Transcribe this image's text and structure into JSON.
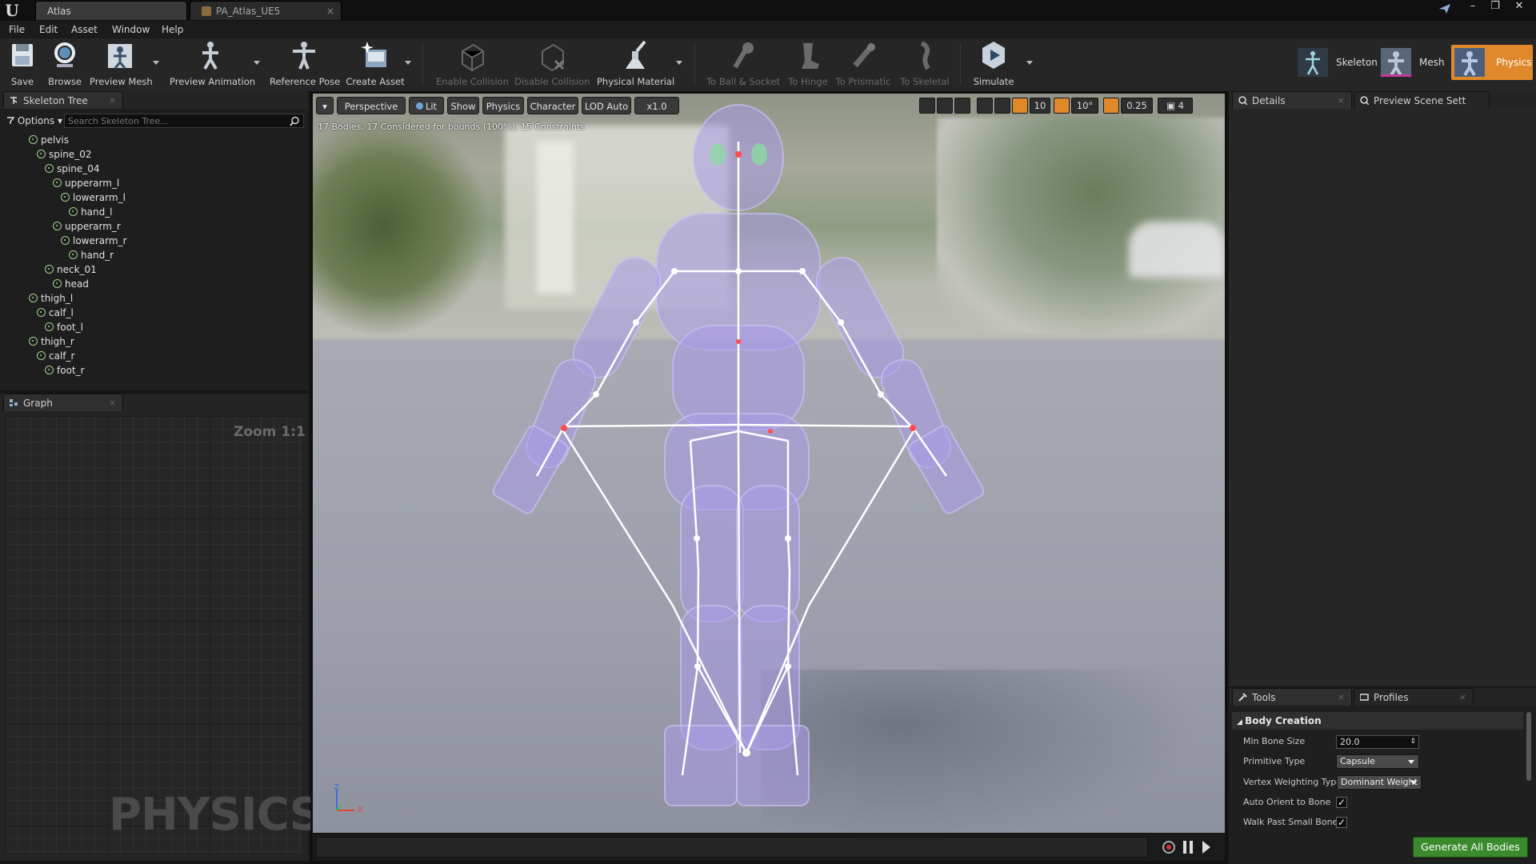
{
  "title_bar": {
    "tabs": [
      {
        "label": "Atlas"
      },
      {
        "label": "PA_Atlas_UE5"
      }
    ]
  },
  "menu": [
    "File",
    "Edit",
    "Asset",
    "Window",
    "Help"
  ],
  "toolbar": {
    "buttons": [
      {
        "label": "Save",
        "icon": "save-icon"
      },
      {
        "label": "Browse",
        "icon": "browse-icon"
      },
      {
        "label": "Preview Mesh",
        "icon": "preview-mesh-icon"
      },
      {
        "label": "Preview Animation",
        "icon": "preview-animation-icon"
      },
      {
        "label": "Reference Pose",
        "icon": "reference-pose-icon"
      },
      {
        "label": "Create Asset",
        "icon": "create-asset-icon"
      },
      {
        "label": "Enable Collision",
        "icon": "enable-collision-icon"
      },
      {
        "label": "Disable Collision",
        "icon": "disable-collision-icon"
      },
      {
        "label": "Physical Material",
        "icon": "physical-material-icon"
      },
      {
        "label": "To Ball & Socket",
        "icon": "ball-socket-icon"
      },
      {
        "label": "To Hinge",
        "icon": "hinge-icon"
      },
      {
        "label": "To Prismatic",
        "icon": "prismatic-icon"
      },
      {
        "label": "To Skeletal",
        "icon": "skeletal-icon"
      },
      {
        "label": "Simulate",
        "icon": "simulate-icon"
      }
    ],
    "modes": [
      {
        "label": "Skeleton"
      },
      {
        "label": "Mesh"
      },
      {
        "label": "Physics",
        "active": true
      }
    ],
    "accent": "#e0892a"
  },
  "skeleton_tree": {
    "tab": "Skeleton Tree",
    "options_label": "Options",
    "search_placeholder": "Search Skeleton Tree...",
    "bones": [
      {
        "name": "pelvis",
        "depth": 0
      },
      {
        "name": "spine_02",
        "depth": 1
      },
      {
        "name": "spine_04",
        "depth": 2
      },
      {
        "name": "upperarm_l",
        "depth": 3
      },
      {
        "name": "lowerarm_l",
        "depth": 4
      },
      {
        "name": "hand_l",
        "depth": 5
      },
      {
        "name": "upperarm_r",
        "depth": 3
      },
      {
        "name": "lowerarm_r",
        "depth": 4
      },
      {
        "name": "hand_r",
        "depth": 5
      },
      {
        "name": "neck_01",
        "depth": 2
      },
      {
        "name": "head",
        "depth": 3
      },
      {
        "name": "thigh_l",
        "depth": 0
      },
      {
        "name": "calf_l",
        "depth": 1
      },
      {
        "name": "foot_l",
        "depth": 2
      },
      {
        "name": "thigh_r",
        "depth": 0
      },
      {
        "name": "calf_r",
        "depth": 1
      },
      {
        "name": "foot_r",
        "depth": 2
      }
    ]
  },
  "graph": {
    "tab": "Graph",
    "zoom": "Zoom 1:1",
    "watermark": "PHYSICS"
  },
  "viewport": {
    "perspective": "Perspective",
    "lit": "Lit",
    "show": "Show",
    "physics": "Physics",
    "character": "Character",
    "lod": "LOD Auto",
    "speed": "x1.0",
    "grid_snap": "10",
    "rotate_snap": "10°",
    "scale_snap": "0.25",
    "camera_speed": "4",
    "stats": "17 Bodies, 17 Considered for bounds (100%), 15 Constraints",
    "axis_z": "Z",
    "axis_x": "X"
  },
  "details": {
    "tab": "Details",
    "preview_tab": "Preview Scene Sett"
  },
  "tools": {
    "tab": "Tools",
    "profiles_tab": "Profiles",
    "section": "Body Creation",
    "min_bone_size_label": "Min Bone Size",
    "min_bone_size": "20.0",
    "primitive_type_label": "Primitive Type",
    "primitive_type": "Capsule",
    "vertex_weighting_label": "Vertex Weighting Type",
    "vertex_weighting": "Dominant Weight",
    "auto_orient_label": "Auto Orient to Bone",
    "walk_past_label": "Walk Past Small Bone",
    "generate_button": "Generate All Bodies",
    "generate_color": "#3c8a2e"
  }
}
